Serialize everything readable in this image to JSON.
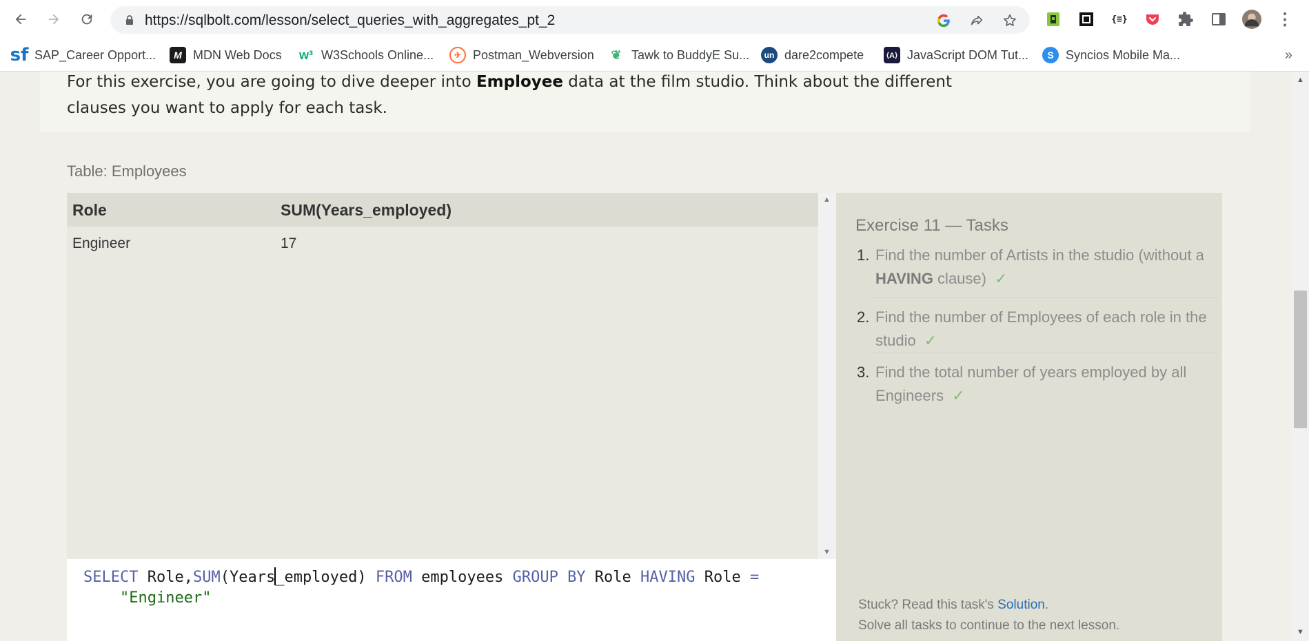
{
  "browser": {
    "url": "https://sqlbolt.com/lesson/select_queries_with_aggregates_pt_2",
    "bookmarks": [
      {
        "label": "SAP_Career Opport...",
        "icon": "sap-icon",
        "color": "#1b73c8"
      },
      {
        "label": "MDN Web Docs",
        "icon": "mdn-icon",
        "color": "#1b1b1b"
      },
      {
        "label": "W3Schools Online...",
        "icon": "w3schools-icon",
        "color": "#04aa6d"
      },
      {
        "label": "Postman_Webversion",
        "icon": "postman-icon",
        "color": "#ff6c37"
      },
      {
        "label": "Tawk to BuddyE Su...",
        "icon": "tawk-icon",
        "color": "#3cb371"
      },
      {
        "label": "dare2compete",
        "icon": "unstop-icon",
        "color": "#1c4980"
      },
      {
        "label": "JavaScript DOM Tut...",
        "icon": "js-dom-icon",
        "color": "#1a1a3a"
      },
      {
        "label": "Syncios Mobile Ma...",
        "icon": "syncios-icon",
        "color": "#2b8ef0"
      }
    ],
    "bookmarks_more": "»"
  },
  "intro": {
    "part1": "For this exercise, you are going to dive deeper into ",
    "bold": "Employee",
    "part2": " data at the film studio. Think about the different clauses you want to apply for each task."
  },
  "table": {
    "caption": "Table: Employees",
    "columns": [
      "Role",
      "SUM(Years_employed)"
    ],
    "rows": [
      [
        "Engineer",
        "17"
      ]
    ]
  },
  "editor": {
    "query_tokens": {
      "select": "SELECT",
      "cols": " Role,",
      "sum": "SUM",
      "arg_a": "(Years",
      "arg_b": "_employed) ",
      "from": "FROM",
      "table": " employees ",
      "group_by": "GROUP BY",
      "role": " Role ",
      "having": "HAVING",
      "role2": " Role ",
      "eq": "=",
      "indent": "    ",
      "value": "\"Engineer\""
    }
  },
  "tasks": {
    "title": "Exercise 11 — Tasks",
    "items": [
      {
        "num": "1.",
        "text_a": "Find the number of Artists in the studio (without a ",
        "bold": "HAVING",
        "text_b": " clause)",
        "check": "✓"
      },
      {
        "num": "2.",
        "text_a": "Find the number of Employees of each role in the studio",
        "bold": "",
        "text_b": "",
        "check": "✓"
      },
      {
        "num": "3.",
        "text_a": "Find the total number of years employed by all Engineers",
        "bold": "",
        "text_b": "",
        "check": "✓"
      }
    ],
    "stuck_prefix": "Stuck? Read this task's ",
    "solution_link": "Solution",
    "stuck_suffix": ".",
    "continue_text": "Solve all tasks to continue to the next lesson."
  }
}
